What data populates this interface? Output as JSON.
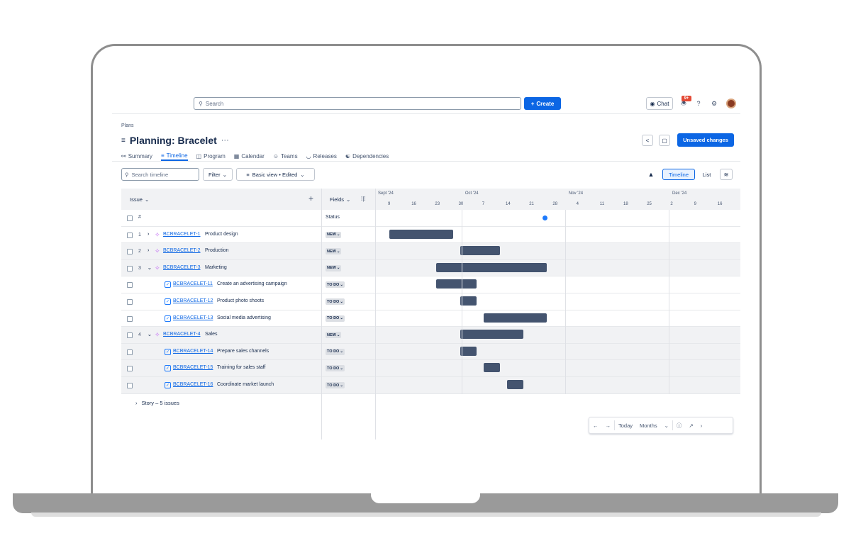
{
  "topbar": {
    "search_placeholder": "Search",
    "create_label": "Create",
    "chat_label": "Chat",
    "notification_count": "9+"
  },
  "page": {
    "breadcrumb": "Plans",
    "title": "Planning: Bracelet",
    "unsaved_label": "Unsaved changes"
  },
  "tabs": [
    {
      "label": "Summary",
      "icon": "globe-icon"
    },
    {
      "label": "Timeline",
      "icon": "timeline-icon",
      "active": true
    },
    {
      "label": "Program",
      "icon": "board-icon"
    },
    {
      "label": "Calendar",
      "icon": "calendar-icon"
    },
    {
      "label": "Teams",
      "icon": "people-icon"
    },
    {
      "label": "Releases",
      "icon": "release-icon"
    },
    {
      "label": "Dependencies",
      "icon": "dependencies-icon"
    }
  ],
  "toolbar": {
    "search_placeholder": "Search timeline",
    "filter_label": "Filter",
    "view_label": "Basic view • Edited",
    "timeline_label": "Timeline",
    "list_label": "List"
  },
  "grid": {
    "issue_header": "Issue",
    "fields_header": "Fields",
    "status_header": "Status",
    "hash": "#",
    "months": [
      "Sept '24",
      "Oct '24",
      "Nov '24",
      "Dec '24"
    ],
    "days": [
      "9",
      "16",
      "23",
      "30",
      "7",
      "14",
      "21",
      "28",
      "4",
      "11",
      "18",
      "25",
      "2",
      "9",
      "16"
    ]
  },
  "rows": [
    {
      "num": "1",
      "key": "BCBRACELET-1",
      "summary": "Product design",
      "status": "NEW",
      "type": "epic",
      "expand": "collapsed",
      "start": 0.6,
      "end": 3.3
    },
    {
      "num": "2",
      "key": "BCBRACELET-2",
      "summary": "Production",
      "status": "NEW",
      "type": "epic",
      "expand": "collapsed",
      "start": 3.6,
      "end": 5.3
    },
    {
      "num": "3",
      "key": "BCBRACELET-3",
      "summary": "Marketing",
      "status": "NEW",
      "type": "epic",
      "expand": "expanded",
      "start": 2.6,
      "end": 7.3
    },
    {
      "num": "",
      "key": "BCBRACELET-11",
      "summary": "Create an advertising campaign",
      "status": "TO DO",
      "type": "task",
      "start": 2.6,
      "end": 4.3
    },
    {
      "num": "",
      "key": "BCBRACELET-12",
      "summary": "Product photo shoots",
      "status": "TO DO",
      "type": "task",
      "start": 3.6,
      "end": 4.3
    },
    {
      "num": "",
      "key": "BCBRACELET-13",
      "summary": "Social media advertising",
      "status": "TO DO",
      "type": "task",
      "start": 4.6,
      "end": 7.3
    },
    {
      "num": "4",
      "key": "BCBRACELET-4",
      "summary": "Sales",
      "status": "NEW",
      "type": "epic",
      "expand": "expanded",
      "start": 3.6,
      "end": 6.3
    },
    {
      "num": "",
      "key": "BCBRACELET-14",
      "summary": "Prepare sales channels",
      "status": "TO DO",
      "type": "task",
      "start": 3.6,
      "end": 4.3
    },
    {
      "num": "",
      "key": "BCBRACELET-15",
      "summary": "Training for sales staff",
      "status": "TO DO",
      "type": "task",
      "start": 4.6,
      "end": 5.3
    },
    {
      "num": "",
      "key": "BCBRACELET-16",
      "summary": "Coordinate market launch",
      "status": "TO DO",
      "type": "task",
      "start": 5.6,
      "end": 6.3
    }
  ],
  "story_group": "Story – 5 issues",
  "nav": {
    "today_label": "Today",
    "scale_label": "Months"
  },
  "colors": {
    "accent": "#0c66e4",
    "bar": "#44546f",
    "epic": "#bf63f3"
  }
}
